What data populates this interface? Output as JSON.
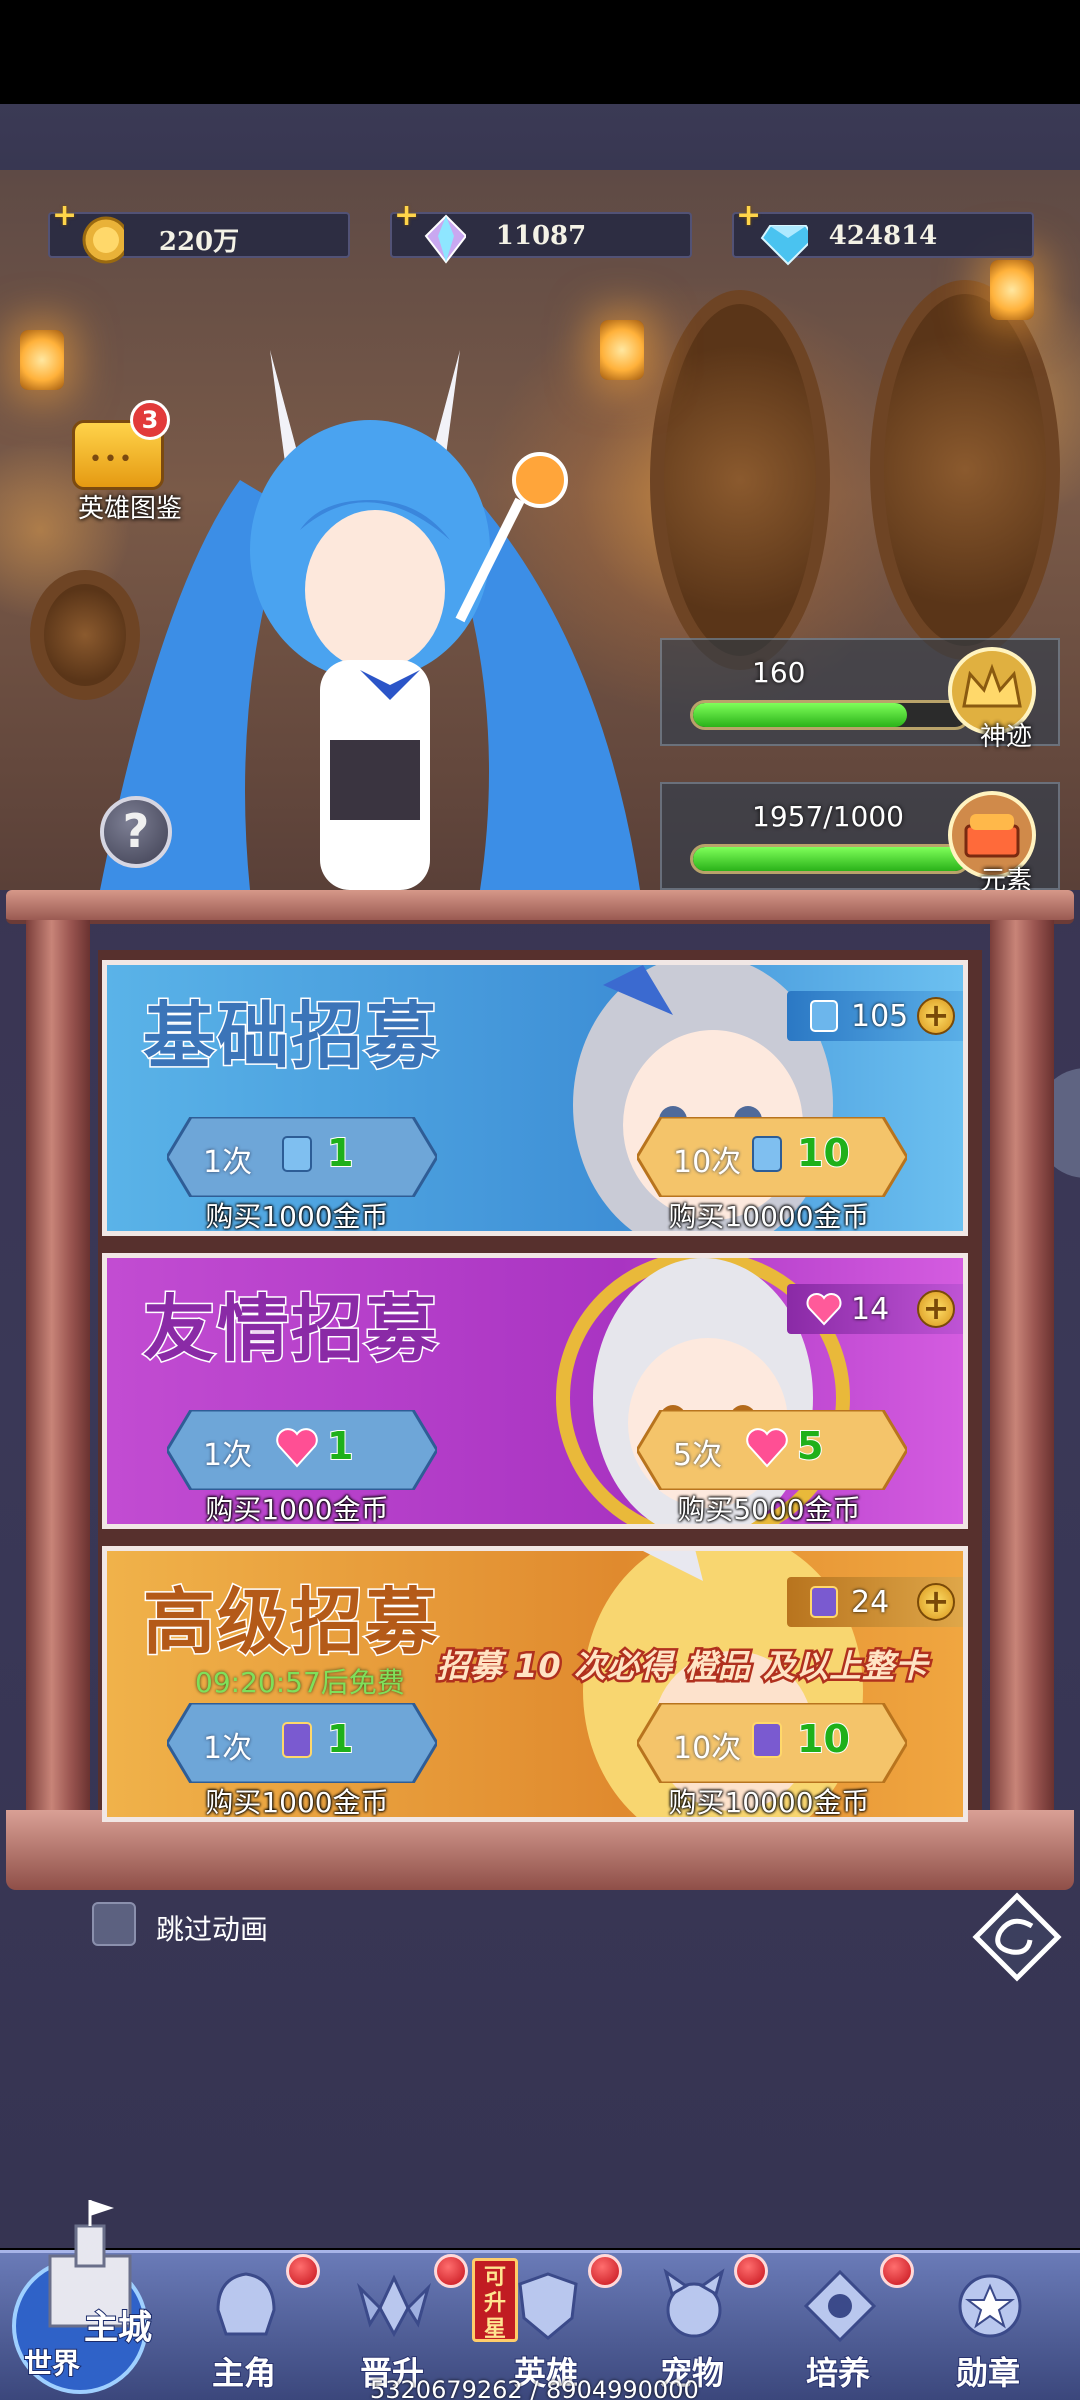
{
  "currencies": [
    {
      "value": "220万",
      "icon": "gold-coin-icon"
    },
    {
      "value": "11087",
      "icon": "rainbow-crystal-icon"
    },
    {
      "value": "424814",
      "icon": "blue-diamond-icon"
    }
  ],
  "hero_atlas": {
    "label": "英雄图鉴",
    "badge": "3"
  },
  "progress": [
    {
      "value_text": "160",
      "label": "神迹",
      "fill_fraction": 0.78
    },
    {
      "value_text": "1957/1000",
      "label": "元素",
      "fill_fraction": 1.0
    }
  ],
  "recruit": [
    {
      "title": "基础招募",
      "count": "105",
      "single": {
        "times": "1次",
        "qty": "1",
        "buy": "购买1000金币"
      },
      "multi": {
        "times": "10次",
        "qty": "10",
        "buy": "购买10000金币"
      }
    },
    {
      "title": "友情招募",
      "count": "14",
      "single": {
        "times": "1次",
        "qty": "1",
        "buy": "购买1000金币"
      },
      "multi": {
        "times": "5次",
        "qty": "5",
        "buy": "购买5000金币"
      }
    },
    {
      "title": "高级招募",
      "count": "24",
      "free_timer": "09:20:57后免费",
      "guarantee": "招募 10 次必得 橙品 及以上整卡",
      "single": {
        "times": "1次",
        "qty": "1",
        "buy": "购买1000金币"
      },
      "multi": {
        "times": "10次",
        "qty": "10",
        "buy": "购买10000金币"
      }
    }
  ],
  "skip_animation": {
    "label": "跳过动画",
    "checked": false
  },
  "nav": {
    "world": {
      "line1": "主城",
      "line2": "世界"
    },
    "items": [
      {
        "label": "主角",
        "icon": "hero-helmet-icon"
      },
      {
        "label": "晋升",
        "icon": "promotion-wings-icon"
      },
      {
        "label": "英雄",
        "icon": "hero-shield-icon"
      },
      {
        "label": "宠物",
        "icon": "pet-icon"
      },
      {
        "label": "培养",
        "icon": "training-icon"
      },
      {
        "label": "勋章",
        "icon": "medal-icon"
      }
    ],
    "upgrade_badge": "可升星"
  },
  "footer_counter": "5320679262 / 8904990000",
  "colors": {
    "basic_bg": "#4a9bd6",
    "friend_bg": "#b43bc7",
    "advanced_bg": "#e29a3a",
    "progress_green": "#3ed12a"
  }
}
